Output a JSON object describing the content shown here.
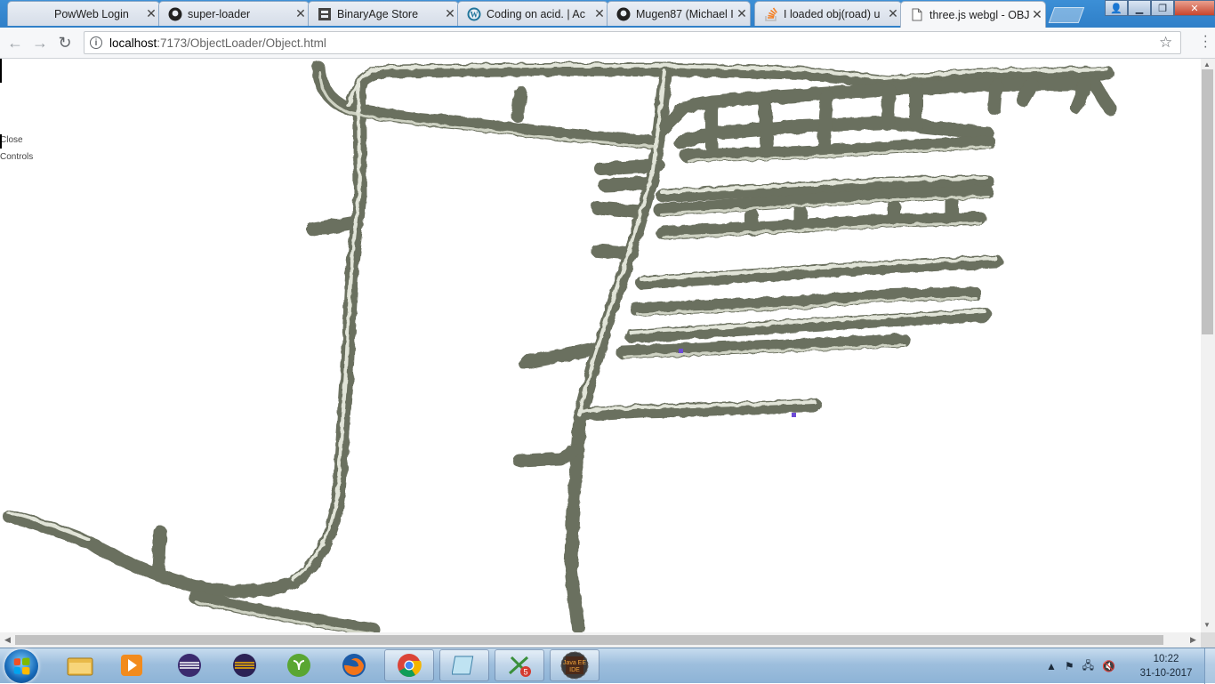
{
  "browser": {
    "tabs": [
      {
        "title": "PowWeb Login",
        "icon": "blank-icon",
        "active": false
      },
      {
        "title": "super-loader",
        "icon": "github-icon",
        "active": false
      },
      {
        "title": "BinaryAge Store",
        "icon": "binaryage-icon",
        "active": false
      },
      {
        "title": "Coding on acid. | Ac",
        "icon": "wordpress-icon",
        "active": false
      },
      {
        "title": "Mugen87 (Michael I",
        "icon": "github-icon",
        "active": false
      },
      {
        "title": "I loaded obj(road) u",
        "icon": "stackoverflow-icon",
        "active": false
      },
      {
        "title": "three.js webgl - OBJ",
        "icon": "page-icon",
        "active": true
      }
    ],
    "window_buttons": {
      "profile": "profile-icon",
      "minimize": "minimize-icon",
      "maximize": "maximize-icon",
      "close": "close-icon"
    },
    "address": {
      "host": "localhost",
      "path": ":7173/ObjectLoader/Object.html"
    },
    "icons": {
      "back": "back-arrow-icon",
      "forward": "forward-arrow-icon",
      "reload": "reload-icon",
      "info": "info-icon",
      "bookmark": "star-icon",
      "menu": "kebab-menu-icon"
    }
  },
  "page": {
    "gui": {
      "close_label": "Close",
      "controls_label": "Controls"
    },
    "scene_color": "#6b6f5e",
    "scene_highlight": "#e8ebdf"
  },
  "taskbar": {
    "apps": [
      "windows-explorer-icon",
      "media-player-icon",
      "eclipse-icon",
      "eclipse-purple-icon",
      "sourcetree-icon",
      "firefox-icon",
      "chrome-icon",
      "notepad-icon",
      "snipping-tool-icon",
      "java-ee-ide-icon"
    ],
    "badge": "5",
    "java_label": "Java EE IDE",
    "clock": {
      "time": "10:22",
      "date": "31-10-2017"
    }
  }
}
